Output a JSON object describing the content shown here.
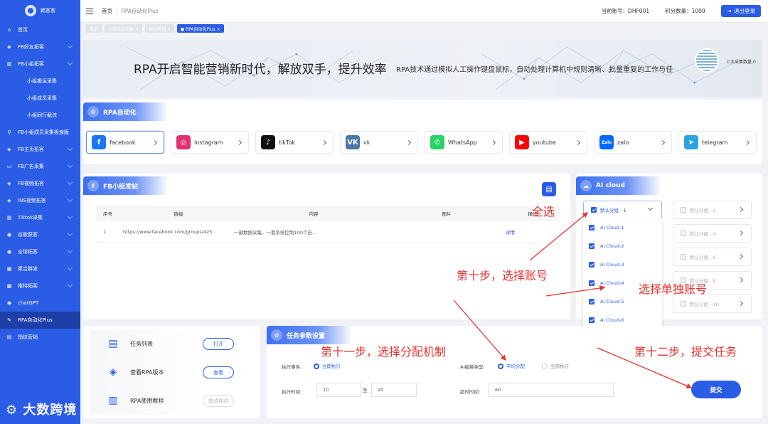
{
  "sidebar": {
    "brand": "韩客客",
    "items": [
      {
        "label": "首页",
        "icon": "home-icon",
        "chev": false,
        "sub": false
      },
      {
        "label": "FB好友拓客",
        "icon": "layers-icon",
        "chev": true,
        "sub": false
      },
      {
        "label": "FB小组拓客",
        "icon": "book-icon",
        "chev": true,
        "sub": false
      },
      {
        "label": "小组搬运采集",
        "icon": "",
        "chev": false,
        "sub": true
      },
      {
        "label": "小组成员采集",
        "icon": "",
        "chev": false,
        "sub": true
      },
      {
        "label": "小组同行截流",
        "icon": "",
        "chev": false,
        "sub": true
      },
      {
        "label": "FB小组成员采集极速版",
        "icon": "search-icon",
        "chev": false,
        "sub": false
      },
      {
        "label": "FB主页拓客",
        "icon": "layers-icon",
        "chev": true,
        "sub": false
      },
      {
        "label": "FB广告采集",
        "icon": "monitor-icon",
        "chev": true,
        "sub": false
      },
      {
        "label": "FB视频拓客",
        "icon": "layers-icon",
        "chev": true,
        "sub": false
      },
      {
        "label": "INS视频拓客",
        "icon": "layers-icon",
        "chev": true,
        "sub": false
      },
      {
        "label": "Tiktok采集",
        "icon": "book-icon",
        "chev": true,
        "sub": false
      },
      {
        "label": "谷歌获客",
        "icon": "globe-icon",
        "chev": true,
        "sub": false
      },
      {
        "label": "全球拓客",
        "icon": "globe-icon",
        "chev": true,
        "sub": false
      },
      {
        "label": "聚合群发",
        "icon": "grid-icon",
        "chev": true,
        "sub": false
      },
      {
        "label": "推特拓客",
        "icon": "grid-icon",
        "chev": true,
        "sub": false
      },
      {
        "label": "chatGPT",
        "icon": "globe-icon",
        "chev": false,
        "sub": false
      },
      {
        "label": "RPA自动化Plus",
        "icon": "edit-icon",
        "chev": false,
        "sub": false,
        "active": true
      },
      {
        "label": "指纹营销",
        "icon": "doc-icon",
        "chev": false,
        "sub": false
      }
    ],
    "watermark": "大数跨境"
  },
  "header": {
    "breadcrumb_home": "首页",
    "breadcrumb_current": "RPA自动化Plus",
    "account_label": "当前账号：DHF001",
    "points_label": "积分数量：1000",
    "logout": "退出登录"
  },
  "tags": [
    {
      "label": "首页",
      "active": false
    },
    {
      "label": "小组搬运采集 ×",
      "active": false
    },
    {
      "label": "指纹营销 ×",
      "active": false
    },
    {
      "label": "● RPA自动化Plus ×",
      "active": true
    }
  ],
  "banner": {
    "title": "RPA开启智能营销新时代，解放双手，提升效率",
    "subtitle": "RPA技术通过模拟人工操作键盘鼠标，自动处理计算机中规则清晰、批量重复的工作与任",
    "side_text": "上次采集数量:0"
  },
  "rpa_section": {
    "title": "RPA自动化"
  },
  "platforms": [
    {
      "name": "facebook",
      "icon": "facebook-icon",
      "color": "#1877f2",
      "glyph": "f",
      "selected": true
    },
    {
      "name": "instagram",
      "icon": "instagram-icon",
      "color": "#e1306c",
      "glyph": "◎",
      "selected": false
    },
    {
      "name": "tikTok",
      "icon": "tiktok-icon",
      "color": "#111111",
      "glyph": "♪",
      "selected": false
    },
    {
      "name": "vk",
      "icon": "vk-icon",
      "color": "#4a76a8",
      "glyph": "VK",
      "selected": false
    },
    {
      "name": "WhatsApp",
      "icon": "whatsapp-icon",
      "color": "#25d366",
      "glyph": "✆",
      "selected": false
    },
    {
      "name": "youtube",
      "icon": "youtube-icon",
      "color": "#ff0000",
      "glyph": "▶",
      "selected": false
    },
    {
      "name": "zalo",
      "icon": "zalo-icon",
      "color": "#0068ff",
      "glyph": "Zalo",
      "selected": false
    },
    {
      "name": "telegram",
      "icon": "telegram-icon",
      "color": "#2aa3df",
      "glyph": "➤",
      "selected": false
    }
  ],
  "fb_section": {
    "title": "FB小组发帖",
    "columns": [
      "序号",
      "链接",
      "内容",
      "图片",
      "操作"
    ],
    "rows": [
      {
        "index": "1",
        "link": "https://www.facebook.com/groups/425...",
        "content": "一键数据采集。一套系统控制100个自...",
        "image": "",
        "action": "详情"
      }
    ]
  },
  "ai_cloud": {
    "title": "AI cloud",
    "group1": "默认分组 - 1",
    "groups": [
      "默认分组 - 2",
      "默认分组 - 4",
      "默认分组 - 6",
      "默认分组 - 8",
      "默认分组 - 10"
    ],
    "accounts": [
      "AI Cloud-1",
      "AI Cloud-2",
      "AI Cloud-3",
      "AI Cloud-4",
      "AI Cloud-5",
      "AI Cloud-6"
    ]
  },
  "tools": [
    {
      "label": "任务列表",
      "btn": "打开",
      "icon": "doc-icon",
      "disabled": false
    },
    {
      "label": "查看RPA版本",
      "btn": "查看",
      "icon": "layers-icon",
      "disabled": false
    },
    {
      "label": "RPA使用教程",
      "btn": "敬请期待",
      "icon": "book-icon",
      "disabled": true
    }
  ],
  "params": {
    "title": "任务参数设置",
    "exec_event_label": "执行事件:",
    "exec_event_option": "立即执行",
    "ai_type_label": "AI编排类型:",
    "ai_option1": "平均分配",
    "ai_option2": "全部执行",
    "exec_time_label": "执行时间:",
    "time_from": "10",
    "time_sep": "至",
    "time_to": "20",
    "timeout_label": "超时时间:",
    "timeout": "60",
    "submit": "提交"
  },
  "annotations": {
    "select_all": "全选",
    "step10": "第十步，选择账号",
    "single": "选择单独账号",
    "step11": "第十一步，选择分配机制",
    "step12": "第十二步，提交任务",
    "color": "#e8322b"
  }
}
